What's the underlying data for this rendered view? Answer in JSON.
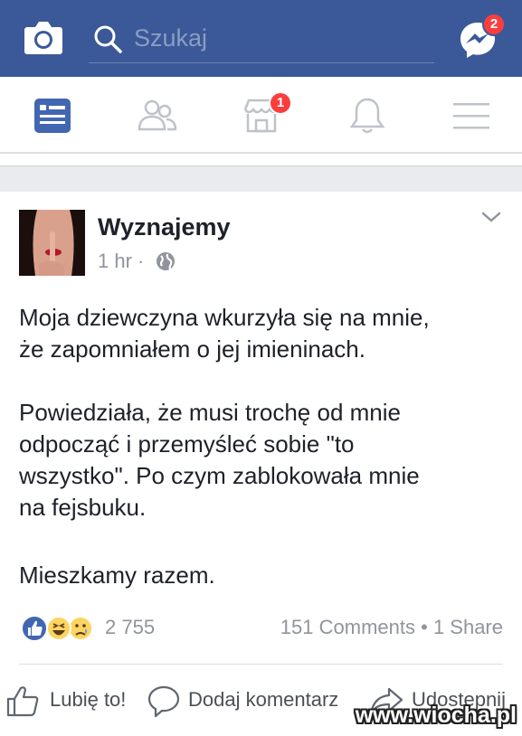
{
  "header": {
    "search_placeholder": "Szukaj",
    "messenger_badge": "2",
    "marketplace_badge": "1"
  },
  "nav": [
    "news-feed-icon",
    "friends-icon",
    "marketplace-icon",
    "notifications-icon",
    "menu-icon"
  ],
  "post": {
    "author": "Wyznajemy",
    "time": "1 hr",
    "dot": "·",
    "paragraphs": [
      "Moja dziewczyna wkurzyła się na mnie,\nże zapomniałem o jej imieninach.",
      "Powiedziała, że musi trochę od mnie\nodpocząć i przemyśleć sobie \"to\nwszystko\". Po czym zablokowała mnie\nna fejsbuku.",
      "Mieszkamy razem."
    ],
    "reactions_count": "2 755",
    "comments": "151 Comments",
    "shares": "1 Share",
    "stat_sep": "•",
    "actions": {
      "like": "Lubię to!",
      "comment": "Dodaj komentarz",
      "share": "Udostępnij"
    }
  },
  "watermark": "www.wiocha.pl",
  "colors": {
    "brand": "#3b5998",
    "badge": "#fa3e3e",
    "nav_active": "#4267b2",
    "nav_inactive": "#bec2c9"
  }
}
